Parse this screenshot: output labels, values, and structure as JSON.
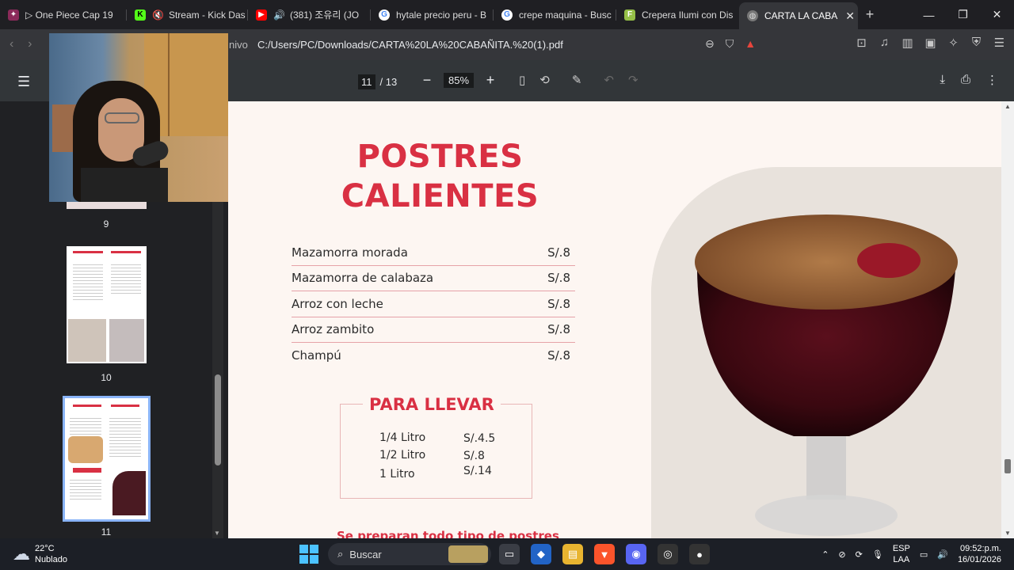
{
  "browser": {
    "tabs": [
      {
        "label": "▷ One Piece Cap 19",
        "icon": "anime-site-icon",
        "color": "#8b2a5a"
      },
      {
        "label": "Stream - Kick Das",
        "icon": "kick-icon",
        "color": "#53fc18"
      },
      {
        "label": "(381) 조유리 (JO",
        "icon": "youtube-icon",
        "color": "#ff0000"
      },
      {
        "label": "hytale precio peru - B",
        "icon": "google-icon",
        "color": "#ffffff"
      },
      {
        "label": "crepe maquina - Busc",
        "icon": "google-icon",
        "color": "#ffffff"
      },
      {
        "label": "Crepera Ilumi con Dis",
        "icon": "shop-icon",
        "color": "#95bf47"
      },
      {
        "label": "CARTA LA CABA",
        "icon": "globe-icon",
        "color": "#bbbbbb",
        "active": true
      }
    ],
    "address_prefix": "nivo",
    "address": "C:/Users/PC/Downloads/CARTA%20LA%20CABAÑITA.%20(1).pdf"
  },
  "pdf_toolbar": {
    "current_page": "11",
    "total_pages": "/ 13",
    "zoom": "85%"
  },
  "thumbnails": [
    {
      "page": "9"
    },
    {
      "page": "10"
    },
    {
      "page": "11",
      "selected": true
    }
  ],
  "menu": {
    "title_line1": "POSTRES",
    "title_line2": "CALIENTES",
    "items": [
      {
        "name": "Mazamorra morada",
        "price": "S/.8"
      },
      {
        "name": "Mazamorra de calabaza",
        "price": "S/.8"
      },
      {
        "name": "Arroz con leche",
        "price": "S/.8"
      },
      {
        "name": "Arroz zambito",
        "price": "S/.8"
      },
      {
        "name": "Champú",
        "price": "S/.8"
      }
    ],
    "takeaway_title": "PARA LLEVAR",
    "takeaway": [
      {
        "size": "1/4 Litro",
        "price": "S/.4.5"
      },
      {
        "size": "1/2 Litro",
        "price": "S/.8"
      },
      {
        "size": "1 Litro",
        "price": "S/.14"
      }
    ],
    "footer": "Se preparan todo tipo de postres"
  },
  "taskbar": {
    "temperature": "22°C",
    "weather": "Nublado",
    "search_placeholder": "Buscar",
    "language_line1": "ESP",
    "language_line2": "LAA",
    "time": "09:52:p.m.",
    "date": "16/01/2026"
  }
}
